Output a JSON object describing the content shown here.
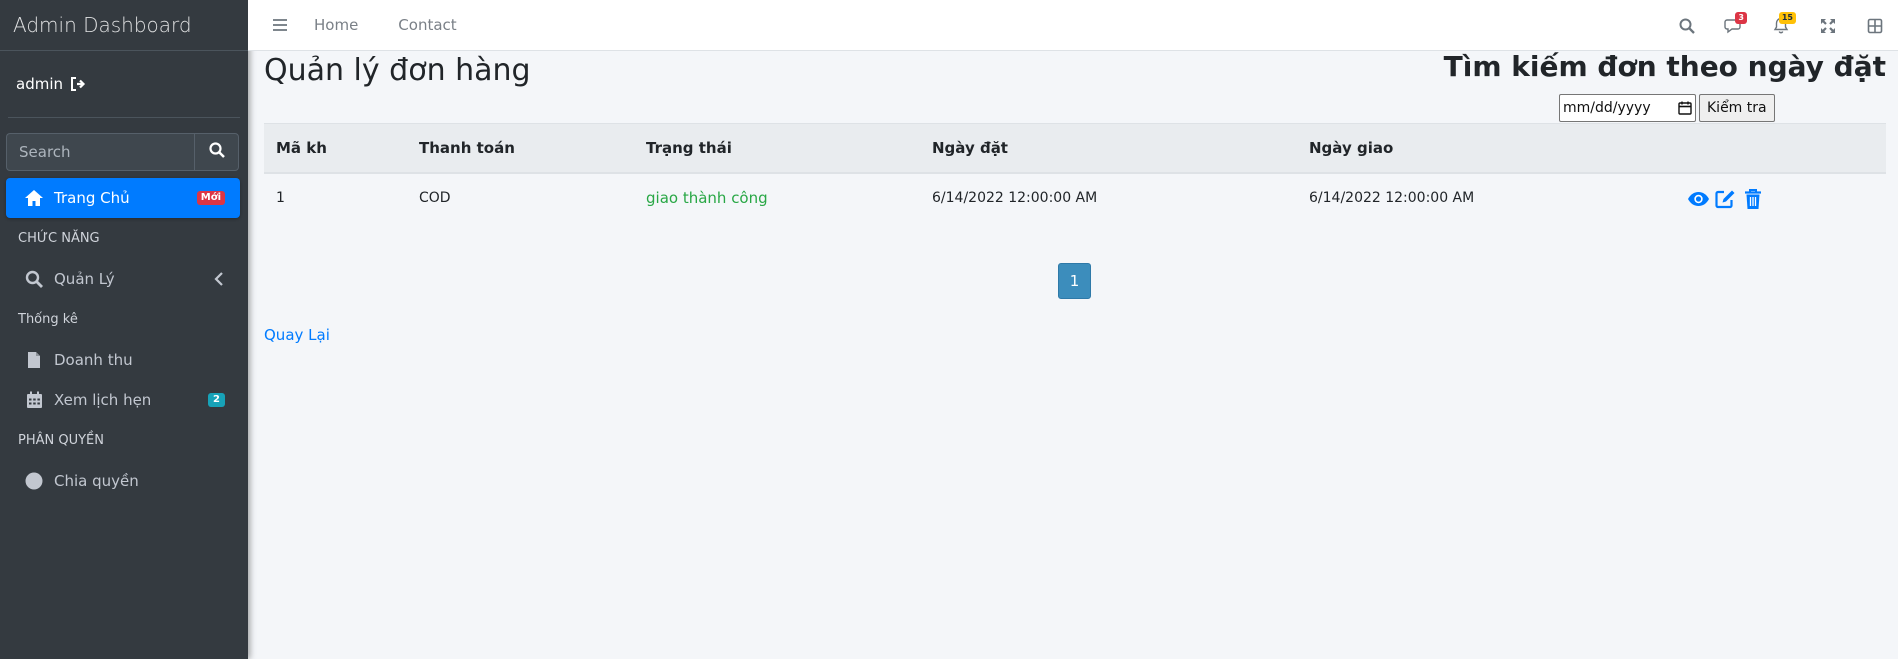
{
  "brand": {
    "title": "Admin Dashboard"
  },
  "user": {
    "name": "admin"
  },
  "sidebar": {
    "search_placeholder": "Search",
    "items": [
      {
        "label": "Trang Chủ",
        "badge": "Mới",
        "icon": "home-icon"
      },
      {
        "header": "CHỨC NĂNG"
      },
      {
        "label": "Quản Lý",
        "icon": "search-icon"
      },
      {
        "header": "Thống kê"
      },
      {
        "label": "Doanh thu",
        "icon": "file-icon"
      },
      {
        "label": "Xem lịch hẹn",
        "badge": "2",
        "icon": "calendar-icon"
      },
      {
        "header": "PHÂN QUYỀN"
      },
      {
        "label": "Chia quyền",
        "icon": "circle-icon"
      }
    ]
  },
  "topbar": {
    "links": [
      "Home",
      "Contact"
    ],
    "messages_count": "3",
    "notifications_count": "15"
  },
  "main": {
    "title": "Quản lý đơn hàng",
    "date_search": {
      "title": "Tìm kiếm đơn theo ngày đặt",
      "date_placeholder": "mm/dd/yyyy",
      "button": "Kiểm tra"
    },
    "table": {
      "columns": [
        "Mã kh",
        "Thanh toán",
        "Trạng thái",
        "Ngày đặt",
        "Ngày giao"
      ],
      "rows": [
        [
          "1",
          "COD",
          "giao thành công",
          "6/14/2022 12:00:00 AM",
          "6/14/2022 12:00:00 AM"
        ]
      ]
    },
    "pagination": {
      "current": "1"
    },
    "back_link": "Quay Lại"
  },
  "colors": {
    "sidebar_bg": "#343a40",
    "primary": "#007bff",
    "status_success": "#28a745",
    "badge_danger": "#dc3545",
    "badge_info": "#17a2b8",
    "badge_warning": "#ffc107"
  }
}
